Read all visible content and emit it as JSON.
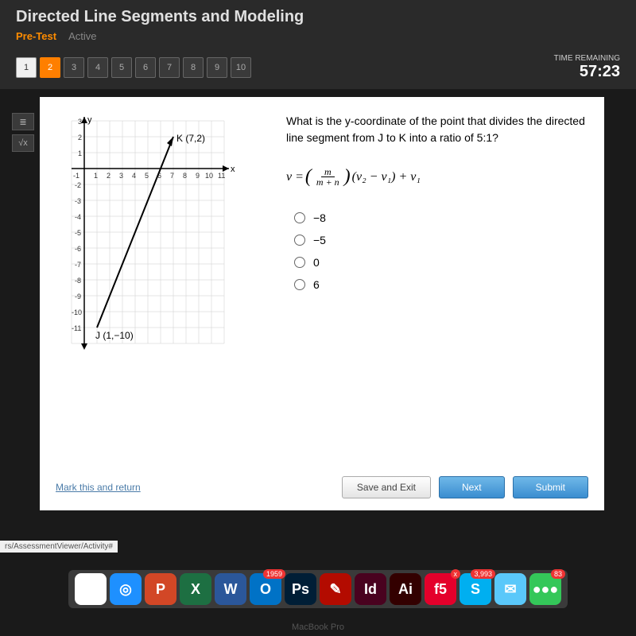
{
  "header": {
    "title": "Directed Line Segments and Modeling",
    "tab_pretest": "Pre-Test",
    "tab_active": "Active"
  },
  "nav": {
    "questions": [
      "1",
      "2",
      "3",
      "4",
      "5",
      "6",
      "7",
      "8",
      "9",
      "10"
    ],
    "current": 2,
    "time_label": "TIME REMAINING",
    "time_value": "57:23"
  },
  "tools": {
    "tool1": "≣",
    "tool2": "√x"
  },
  "question": {
    "text": "What is the y-coordinate of the point that divides the directed line segment from J to K into a ratio of 5:1?",
    "formula_lhs": "v =",
    "formula_frac_num": "m",
    "formula_frac_den": "m + n",
    "formula_mid": "(v₂ − v₁) + v₁",
    "options": [
      "−8",
      "−5",
      "0",
      "6"
    ]
  },
  "graph": {
    "point_k_label": "K (7,2)",
    "point_j_label": "J (1,−10)",
    "x_label": "x",
    "y_label": "y"
  },
  "chart_data": {
    "type": "scatter",
    "title": "",
    "xlabel": "x",
    "ylabel": "y",
    "xlim": [
      -1,
      11
    ],
    "ylim": [
      -11,
      3
    ],
    "series": [
      {
        "name": "segment JK",
        "x": [
          1,
          7
        ],
        "y": [
          -10,
          2
        ],
        "style": "line-arrow"
      }
    ],
    "points": [
      {
        "name": "J",
        "x": 1,
        "y": -10,
        "label": "J (1,−10)"
      },
      {
        "name": "K",
        "x": 7,
        "y": 2,
        "label": "K (7,2)"
      }
    ]
  },
  "footer": {
    "mark_link": "Mark this and return",
    "save_exit": "Save and Exit",
    "next": "Next",
    "submit": "Submit"
  },
  "url_hint": "rs/AssessmentViewer/Activity#",
  "dock": {
    "items": [
      {
        "name": "chrome",
        "bg": "#fff",
        "txt": "◉"
      },
      {
        "name": "safari",
        "bg": "#1e90ff",
        "txt": "◎"
      },
      {
        "name": "powerpoint",
        "bg": "#d24726",
        "txt": "P"
      },
      {
        "name": "excel",
        "bg": "#1d6f42",
        "txt": "X"
      },
      {
        "name": "word",
        "bg": "#2b579a",
        "txt": "W"
      },
      {
        "name": "outlook",
        "bg": "#0072c6",
        "txt": "O",
        "badge": "1959"
      },
      {
        "name": "photoshop",
        "bg": "#001e36",
        "txt": "Ps"
      },
      {
        "name": "acrobat",
        "bg": "#b30b00",
        "txt": "✎"
      },
      {
        "name": "indesign",
        "bg": "#49021f",
        "txt": "Id"
      },
      {
        "name": "illustrator",
        "bg": "#330000",
        "txt": "Ai"
      },
      {
        "name": "f5",
        "bg": "#e4002b",
        "txt": "f5",
        "badge": "x"
      },
      {
        "name": "skype",
        "bg": "#00aff0",
        "txt": "S",
        "badge": "3,993"
      },
      {
        "name": "mail",
        "bg": "#5ac8fa",
        "txt": "✉"
      },
      {
        "name": "messages",
        "bg": "#34c759",
        "txt": "●●●",
        "badge": "83"
      }
    ]
  },
  "laptop": "MacBook Pro"
}
